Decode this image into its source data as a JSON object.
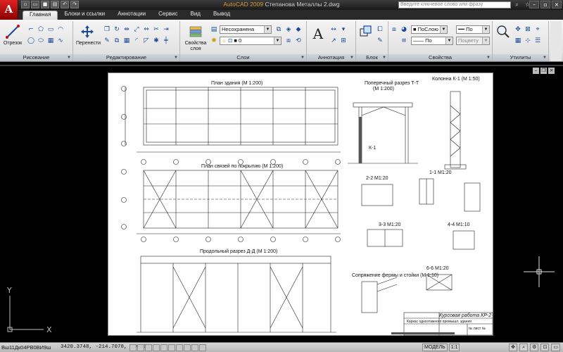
{
  "titlebar": {
    "app_name": "AutoCAD 2009",
    "file_name": "Степанова Металлы 2.dwg",
    "help_search_placeholder": "Введите ключевое слово или фразу",
    "logo_letter": "A"
  },
  "ribbon_tabs": [
    {
      "label": "Главная",
      "active": true
    },
    {
      "label": "Блоки и ссылки",
      "active": false
    },
    {
      "label": "Аннотации",
      "active": false
    },
    {
      "label": "Сервис",
      "active": false
    },
    {
      "label": "Вид",
      "active": false
    },
    {
      "label": "Вывод",
      "active": false
    }
  ],
  "panels": {
    "draw": {
      "title": "Рисование",
      "line_button": "Отрезок"
    },
    "modify": {
      "title": "Редактирование",
      "move_button": "Перенести"
    },
    "layers": {
      "title": "Слои",
      "layer_props_button": "Свойства слоя",
      "state_dropdown": "Несохранена",
      "layer_dropdown": "0"
    },
    "annotation": {
      "title": "Аннотация",
      "text_glyph": "A"
    },
    "block": {
      "title": "Блок"
    },
    "properties": {
      "title": "Свойства",
      "color_dropdown": "ПоСлою",
      "linetype_dropdown": "По",
      "lineweight_dropdown": "По",
      "plotstyle_dropdown": "Поцвету"
    },
    "utilities": {
      "title": "Утилиты"
    }
  },
  "drawing": {
    "captions": {
      "plan": "План здания (М 1:200)",
      "bracing": "План связей по покрытию (М 1:200)",
      "longitudinal": "Продольный разрез Д-Д (М 1:200)",
      "cross_section": "Поперечный разрез Т-Т",
      "cross_scale": "(М 1:200)",
      "column": "Колонна К-1 (М 1:50)",
      "sec22": "2-2 М1:20",
      "sec11": "1-1 М1:20",
      "sec33": "3-3 М1:20",
      "sec44": "4-4 М1:10",
      "sec66": "6-6 М1:20",
      "truss": "Сопряжение фермы и стойки (М 1:10)",
      "title_block": "Курсовая работа  КР-2",
      "title_sub": "Каркас одноэтажного промышл. здания",
      "k1_label": "К-1",
      "scale_note": "№ лист №"
    }
  },
  "statusbar": {
    "command_text": "Вш11Дк04РВ0ВИ9ш",
    "coordinates": "3420.3748, -214.7078, 0.0000",
    "model_label": "МОДЕЛЬ",
    "scale_label": "1:1"
  },
  "ucs": {
    "x_label": "X",
    "y_label": "Y"
  },
  "colors": {
    "accent_red": "#c41010",
    "ribbon_panel_title": "#b8c0c9",
    "drawing_bg": "#000000"
  }
}
